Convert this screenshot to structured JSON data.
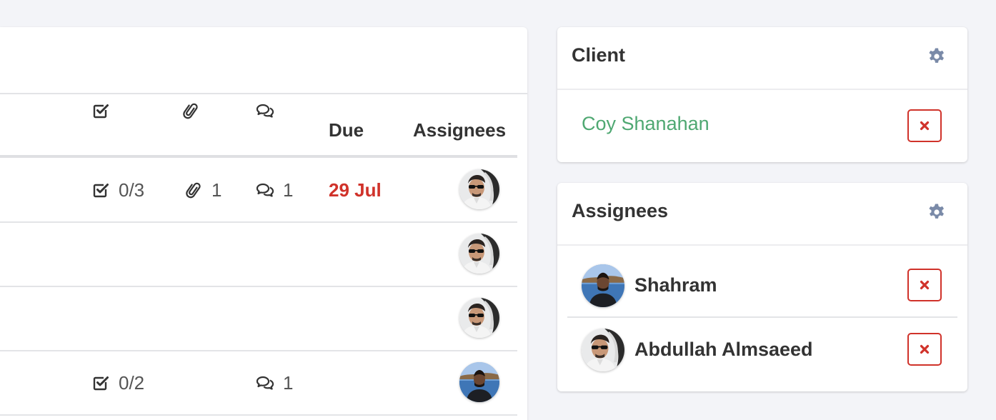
{
  "task_table": {
    "columns": {
      "checklist_icon": "check-square-icon",
      "attachments_icon": "paperclip-icon",
      "comments_icon": "comments-icon",
      "due": "Due",
      "assignees": "Assignees"
    },
    "rows": [
      {
        "checklist": "0/3",
        "attachments": "1",
        "comments": "1",
        "due": "29 Jul",
        "assignee_avatar": "avatar-abdullah"
      },
      {
        "checklist": "",
        "attachments": "",
        "comments": "",
        "due": "",
        "assignee_avatar": "avatar-abdullah"
      },
      {
        "checklist": "",
        "attachments": "",
        "comments": "",
        "due": "",
        "assignee_avatar": "avatar-abdullah"
      },
      {
        "checklist": "0/2",
        "attachments": "",
        "comments": "1",
        "due": "",
        "assignee_avatar": "avatar-shahram"
      }
    ]
  },
  "client_card": {
    "title": "Client",
    "settings_icon": "gear-icon",
    "client_name": "Coy Shanahan",
    "remove_icon": "times-icon"
  },
  "assignees_card": {
    "title": "Assignees",
    "settings_icon": "gear-icon",
    "people": [
      {
        "name": "Shahram",
        "avatar": "avatar-shahram"
      },
      {
        "name": "Abdullah Almsaeed",
        "avatar": "avatar-abdullah"
      }
    ]
  },
  "colors": {
    "background": "#f3f4f8",
    "due_overdue": "#d0322a",
    "client_link": "#4fa872",
    "remove_button": "#d0322a",
    "gear": "#7a8aa8"
  }
}
